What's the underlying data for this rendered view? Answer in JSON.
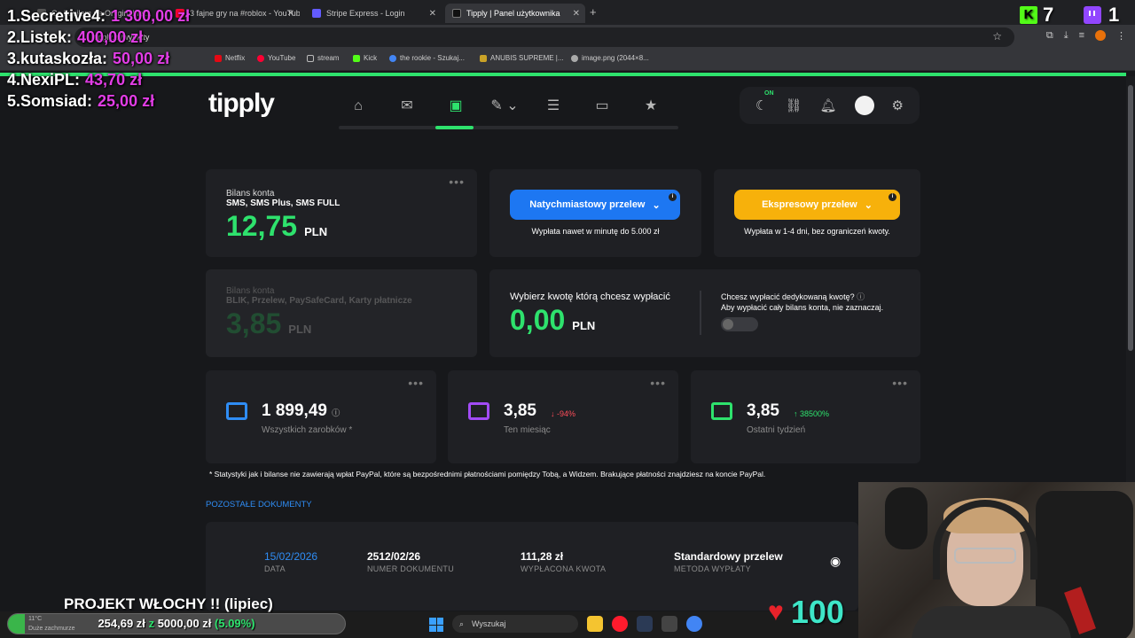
{
  "browser": {
    "tabs": [
      {
        "label": "Co kupiłem na Oryginalnej...",
        "active": false
      },
      {
        "label": "3 fajne gry na #roblox - YouTube",
        "active": false
      },
      {
        "label": "Stripe Express - Login",
        "active": false
      },
      {
        "label": "Tipply | Panel użytkownika",
        "active": true
      }
    ],
    "url": "tipply.pl/wyplaty",
    "bookmarks": [
      "Netflix",
      "YouTube",
      "stream",
      "Kick",
      "the rookie - Szukaj...",
      "ANUBIS SUPREME |...",
      "image.png (2044×8..."
    ]
  },
  "leaderboard": [
    {
      "name": "1.Secretive4:",
      "amount": "1 300,00 zł"
    },
    {
      "name": "2.Listek:",
      "amount": "400,00 zł"
    },
    {
      "name": "3.kutaskozła:",
      "amount": "50,00 zł"
    },
    {
      "name": "4.NexiPL:",
      "amount": "43,70 zł"
    },
    {
      "name": "5.Somsiad:",
      "amount": "25,00 zł"
    }
  ],
  "socials": {
    "kick_count": "7",
    "twitch_count": "1"
  },
  "brand": "tipply",
  "nav": {
    "items": [
      "home-icon",
      "inbox-icon",
      "wallet-icon",
      "edit-icon",
      "layers-icon",
      "window-icon",
      "star-icon"
    ],
    "active_index": 2,
    "right": {
      "on_label": "ON"
    }
  },
  "balance": {
    "label": "Bilans konta",
    "sublabel": "SMS, SMS Plus, SMS FULL",
    "value": "12,75",
    "unit": "PLN"
  },
  "instant": {
    "button": "Natychmiastowy przelew",
    "sub": "Wypłata nawet w minutę do 5.000 zł"
  },
  "express": {
    "button": "Ekspresowy przelew",
    "sub": "Wypłata w 1-4 dni, bez ograniczeń kwoty."
  },
  "balance2": {
    "label": "Bilans konta",
    "sublabel": "BLIK, Przelew, PaySafeCard, Karty płatnicze",
    "value": "3,85",
    "unit": "PLN"
  },
  "withdraw": {
    "label": "Wybierz kwotę którą chcesz wypłacić",
    "value": "0,00",
    "unit": "PLN",
    "dedicated_q": "Chcesz wypłacić dedykowaną kwotę?",
    "dedicated_hint": "Aby wypłacić cały bilans konta, nie zaznaczaj."
  },
  "stats": [
    {
      "value": "1 899,49",
      "label": "Wszystkich zarobków *",
      "delta": "",
      "icon_color": "#2f8df5"
    },
    {
      "value": "3,85",
      "label": "Ten miesiąc",
      "delta": "↓ -94%",
      "delta_color": "#ff4d5a",
      "icon_color": "#a24bf5"
    },
    {
      "value": "3,85",
      "label": "Ostatni tydzień",
      "delta": "↑ 38500%",
      "delta_color": "#2ee26d",
      "icon_color": "#2ee26d"
    }
  ],
  "note": "* Statystyki jak i bilanse nie zawierają wpłat PayPal, które są bezpośrednimi płatnościami pomiędzy Tobą, a Widzem. Brakujące płatności znajdziesz na koncie PayPal.",
  "docs": {
    "title": "POZOSTAŁE DOKUMENTY",
    "row": {
      "date": "15/02/2026",
      "date_label": "DATA",
      "number": "2512/02/26",
      "number_label": "NUMER DOKUMENTU",
      "amount": "111,28 zł",
      "amount_label": "WYPŁACONA KWOTA",
      "method": "Standardowy przelew",
      "method_label": "METODA WYPŁATY"
    }
  },
  "goal": {
    "title": "PROJEKT WŁOCHY !! (lipiec)",
    "current": "254,69 zł",
    "sep": "z",
    "target": "5000,00 zł",
    "percent_text": "(5.09%)",
    "progress": 0.0509
  },
  "hearts": {
    "count": "100"
  },
  "weather": {
    "temp": "11°C",
    "desc": "Duże zachmurze"
  },
  "taskbar": {
    "search": "Wyszukaj"
  }
}
